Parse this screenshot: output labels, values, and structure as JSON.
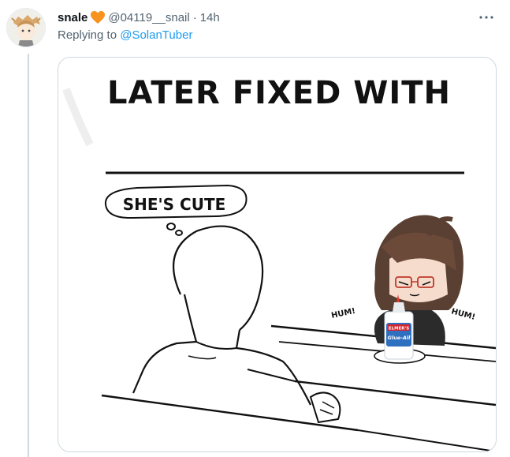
{
  "tweet": {
    "display_name": "snale",
    "handle": "@04119__snail",
    "separator": "·",
    "time": "14h",
    "reply_prefix": "Replying to ",
    "reply_to": "@SolanTuber"
  },
  "comic": {
    "title": "LATER FIXED WITH",
    "thought": "SHE'S CUTE",
    "hum_left": "HUM!",
    "hum_right": "HUM!",
    "bottle_brand": "ELMER'S",
    "bottle_product": "Glue-All"
  },
  "colors": {
    "heart": "#f7931e",
    "link": "#1d9bf0",
    "secondary_text": "#536471",
    "border": "#cfd9de"
  },
  "icons": [
    "heart-icon",
    "more-icon"
  ]
}
